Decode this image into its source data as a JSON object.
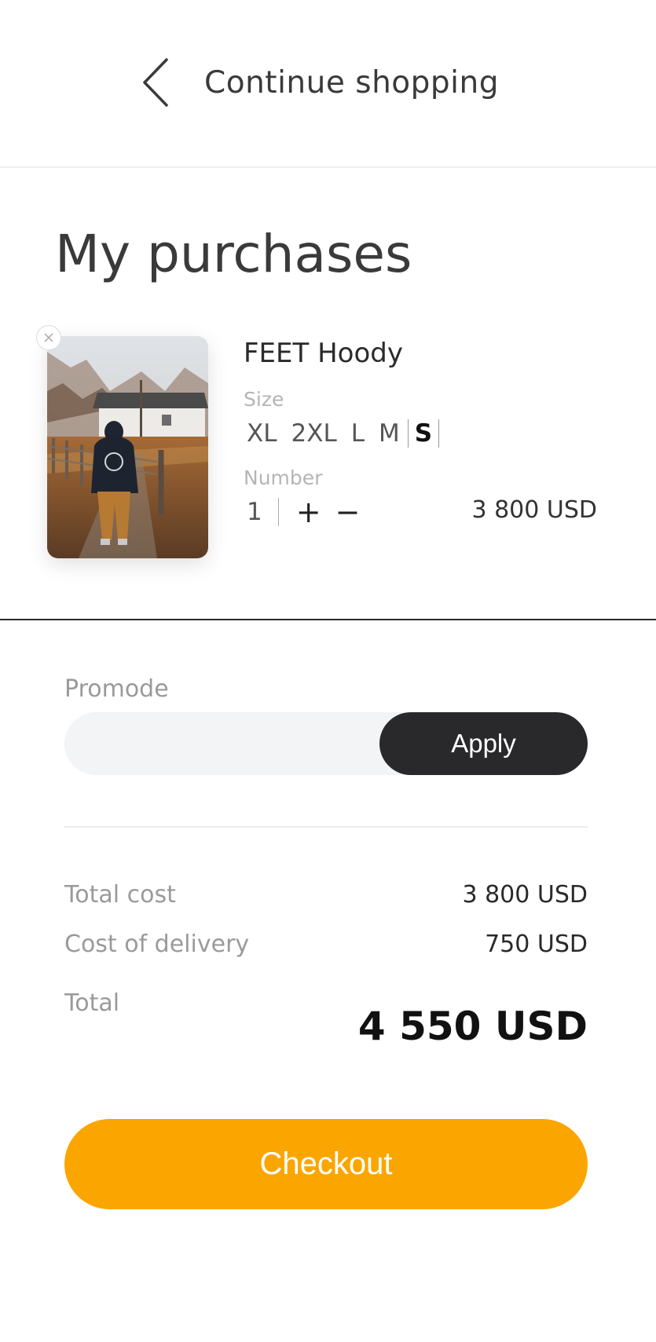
{
  "header": {
    "back_label": "Continue shopping"
  },
  "page": {
    "title": "My purchases"
  },
  "cart": {
    "items": [
      {
        "name": "FEET Hoody",
        "size_label": "Size",
        "sizes": [
          "XL",
          "2XL",
          "L",
          "M",
          "S"
        ],
        "selected_size": "S",
        "number_label": "Number",
        "quantity": "1",
        "plus": "+",
        "minus": "−",
        "price": "3 800 USD"
      }
    ]
  },
  "promo": {
    "label": "Promode",
    "value": "",
    "apply_label": "Apply"
  },
  "summary": {
    "total_cost_label": "Total cost",
    "total_cost_value": "3 800 USD",
    "delivery_label": "Cost of delivery",
    "delivery_value": "750 USD",
    "total_label": "Total",
    "total_value": "4 550 USD"
  },
  "checkout": {
    "label": "Checkout"
  },
  "colors": {
    "accent": "#fba600",
    "apply_button": "#29292c",
    "promo_background": "#f3f4f6"
  },
  "icons": {
    "back": "chevron-left-icon",
    "remove": "close-icon"
  }
}
